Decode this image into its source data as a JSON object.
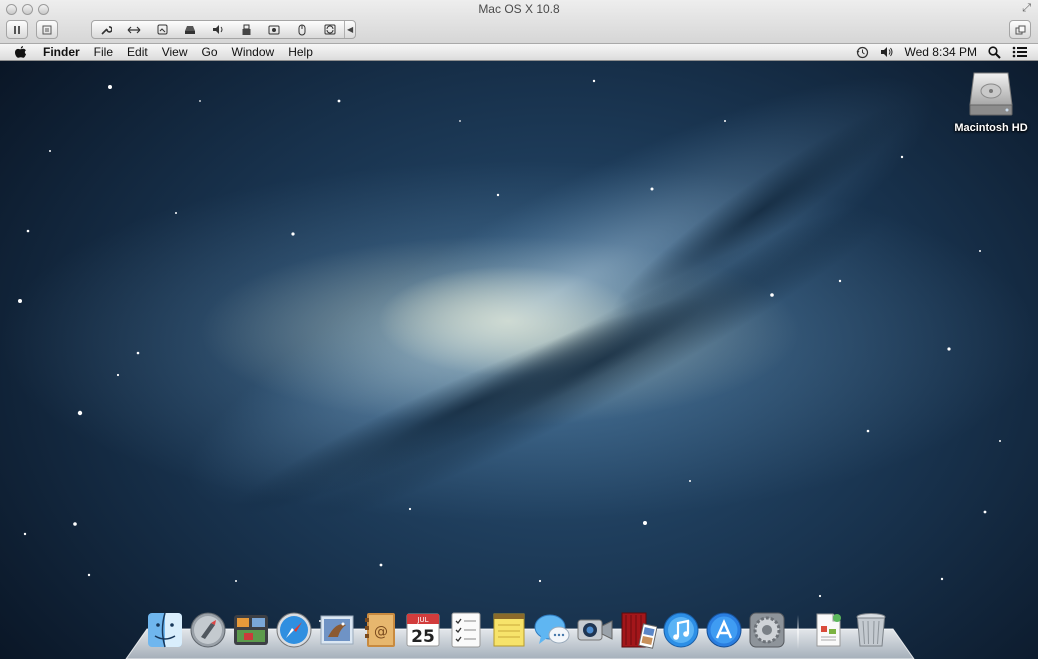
{
  "vm_window": {
    "title": "Mac OS X 10.8",
    "toolbar": {
      "tools": [
        "wrench-icon",
        "resize-arrows-icon",
        "screenshot-icon",
        "drive-icon",
        "speaker-icon",
        "usb-icon",
        "camera-icon",
        "mouse-icon",
        "sync-icon"
      ]
    }
  },
  "menubar": {
    "app_name": "Finder",
    "menus": [
      "File",
      "Edit",
      "View",
      "Go",
      "Window",
      "Help"
    ],
    "clock": "Wed 8:34 PM"
  },
  "desktop": {
    "icons": [
      {
        "label": "Macintosh HD",
        "icon": "hard-drive-icon"
      }
    ]
  },
  "dock": {
    "apps": [
      "finder-icon",
      "launchpad-icon",
      "mission-control-icon",
      "safari-icon",
      "mail-icon",
      "contacts-icon",
      "calendar-icon",
      "reminders-icon",
      "notes-icon",
      "messages-icon",
      "facetime-icon",
      "photo-booth-icon",
      "itunes-icon",
      "app-store-icon",
      "system-preferences-icon"
    ],
    "calendar_date": "25",
    "calendar_month": "JUL",
    "docs": [
      "document-stack-icon",
      "trash-icon"
    ]
  },
  "colors": {
    "menubar_bg": "#e8e8e8",
    "vm_chrome_bg": "#e2e2e2",
    "desktop_deep": "#0a1626",
    "galaxy_core": "#fff4c8"
  }
}
